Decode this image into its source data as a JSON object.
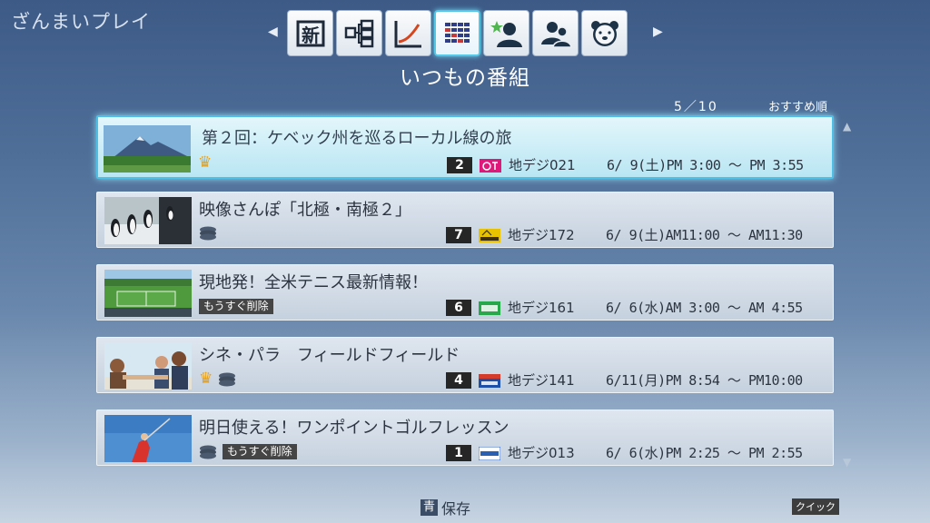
{
  "app_title": "ざんまいプレイ",
  "tabs": [
    {
      "name": "new-icon",
      "glyph": "新"
    },
    {
      "name": "tree-icon"
    },
    {
      "name": "chart-icon"
    },
    {
      "name": "grid-icon",
      "active": true
    },
    {
      "name": "star-person-icon"
    },
    {
      "name": "people-icon"
    },
    {
      "name": "bear-icon"
    }
  ],
  "page_title": "いつもの番組",
  "counter": "5／10",
  "sort_label": "おすすめ順",
  "programs": [
    {
      "title": "第２回：ケベック州を巡るローカル線の旅",
      "crown": true,
      "disc": false,
      "delete_soon": false,
      "ch_num": "2",
      "channel": "地デジ021",
      "datetime": "6/ 9(土)PM 3:00 ～ PM 3:55",
      "logo_color": "#e0187a"
    },
    {
      "title": "映像さんぽ「北極・南極２」",
      "crown": false,
      "disc": true,
      "delete_soon": false,
      "ch_num": "7",
      "channel": "地デジ172",
      "datetime": "6/ 9(土)AM11:00 ～ AM11:30",
      "logo_color": "#e8c200"
    },
    {
      "title": "現地発！全米テニス最新情報！",
      "crown": false,
      "disc": false,
      "delete_soon": true,
      "ch_num": "6",
      "channel": "地デジ161",
      "datetime": "6/ 6(水)AM 3:00 ～ AM 4:55",
      "logo_color": "#27a84a"
    },
    {
      "title": "シネ・パラ　フィールドフィールド",
      "crown": true,
      "disc": true,
      "delete_soon": false,
      "ch_num": "4",
      "channel": "地デジ141",
      "datetime": "6/11(月)PM 8:54 ～ PM10:00",
      "logo_color": "#1d4fa8"
    },
    {
      "title": "明日使える！ワンポイントゴルフレッスン",
      "crown": false,
      "disc": true,
      "delete_soon": true,
      "ch_num": "1",
      "channel": "地デジ013",
      "datetime": "6/ 6(水)PM 2:25 ～ PM 2:55",
      "logo_color": "#2a5fb4"
    }
  ],
  "delete_soon_label": "もうすぐ削除",
  "crown_glyph": "♛",
  "bottom": {
    "key": "青",
    "label": "保存",
    "quick": "クイック"
  },
  "colors": {
    "selected_border": "#4fbfe6",
    "crown": "#e7a21c"
  }
}
